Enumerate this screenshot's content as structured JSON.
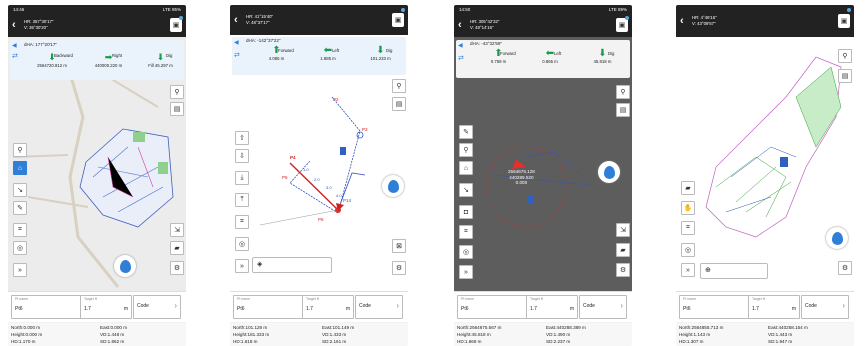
{
  "screens": [
    {
      "time": "14:46",
      "net": "LTE",
      "battery": "95%",
      "hr": "HR: 357°30'17\"",
      "v": "V: 36°30'20\"",
      "dha": "dHA: 177°20'17\"",
      "arrows": [
        {
          "label": "Backward",
          "value": "2564720.812 m"
        },
        {
          "label": "Right",
          "value": "440000.220 m"
        },
        {
          "label": "Dig",
          "value": "Fill 45.297 m"
        }
      ],
      "point_name_title": "Pt name",
      "point_name": "Pt6",
      "target_title": "Target H",
      "target": "1.7",
      "unit": "m",
      "code": "Code",
      "north": "North:0.000 m",
      "east": "East:0.000 m",
      "height": "Height:0.000 m",
      "vd": "VD:1.448 m",
      "hd": "HD:1.170 m",
      "sd": "SD:1.862 m"
    },
    {
      "hr": "HR: 41°15'40\"",
      "v": "V: 48°37'17\"",
      "dha": "dHA: -142°37'22\"",
      "arrows": [
        {
          "label": "Forward",
          "value": "4.085 m"
        },
        {
          "label": "Left",
          "value": "1.885 m"
        },
        {
          "label": "Dig",
          "value": "101.233 m"
        }
      ],
      "point_name_title": "Pt name",
      "point_name": "Pt6",
      "target_title": "Target H",
      "target": "1.7",
      "unit": "m",
      "code": "Code",
      "north": "North:101.128 m",
      "east": "East:101.149 m",
      "height": "Height:181.333 m",
      "vd": "VD:1.433 m",
      "hd": "HD:1.618 m",
      "sd": "SD:2.161 m",
      "labels": [
        "P2",
        "P3",
        "P4",
        "P5",
        "P6",
        "P14",
        "1.0",
        "2.0",
        "3.0",
        "4.0"
      ]
    },
    {
      "time": "14:50",
      "net": "LTE",
      "battery": "89%",
      "hr": "HR: 305°42'32\"",
      "v": "V: 48°14'16\"",
      "dha": "dHA: -43°32'59\"",
      "arrows": [
        {
          "label": "Forward",
          "value": "0.759 m"
        },
        {
          "label": "Left",
          "value": "0.865 m"
        },
        {
          "label": "Dig",
          "value": "45.818 m"
        }
      ],
      "stake_n": "2564676.128",
      "stake_e": "440289.520",
      "stake_h": "0.000",
      "point_name_title": "Pt name",
      "point_name": "Pt6",
      "target_title": "Target H",
      "target": "1.7",
      "unit": "m",
      "code": "Code",
      "north": "North:2564675.567 m",
      "east": "East:440288.389 m",
      "height": "Height:45.818 m",
      "vd": "VD:1.490 m",
      "hd": "HD:1.669 m",
      "sd": "SD:2.237 m"
    },
    {
      "hr": "HR: 4°46'16\"",
      "v": "V: 43°09'57\"",
      "point_name_title": "Pt name",
      "point_name": "Pt6",
      "target_title": "Target H",
      "target": "1.7",
      "unit": "m",
      "code": "Code",
      "north": "North:2564855.713 m",
      "east": "East:440258.154 m",
      "height": "Height:1.143 m",
      "vd": "VD:1.443 m",
      "hd": "HD:1.307 m",
      "sd": "SD:1.947 m"
    }
  ],
  "colors": {
    "header": "#222222",
    "accent": "#2f7ed8",
    "arrow": "#1a9a4a"
  }
}
